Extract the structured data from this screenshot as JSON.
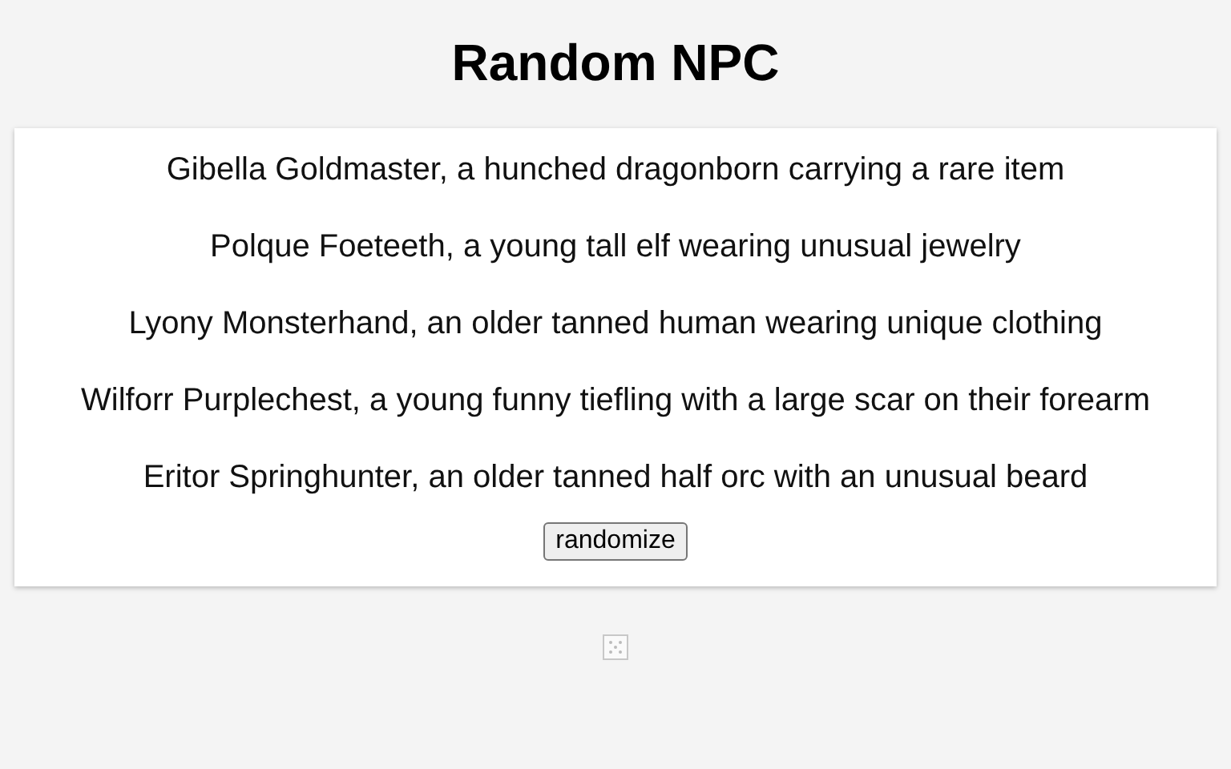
{
  "title": "Random NPC",
  "npcs": [
    "Gibella Goldmaster, a hunched dragonborn carrying a rare item",
    "Polque Foeteeth, a young tall elf wearing unusual jewelry",
    "Lyony Monsterhand, an older tanned human wearing unique clothing",
    "Wilforr Purplechest, a young funny tiefling with a large scar on their forearm",
    "Eritor Springhunter, an older tanned half orc with an unusual beard"
  ],
  "button": "randomize"
}
